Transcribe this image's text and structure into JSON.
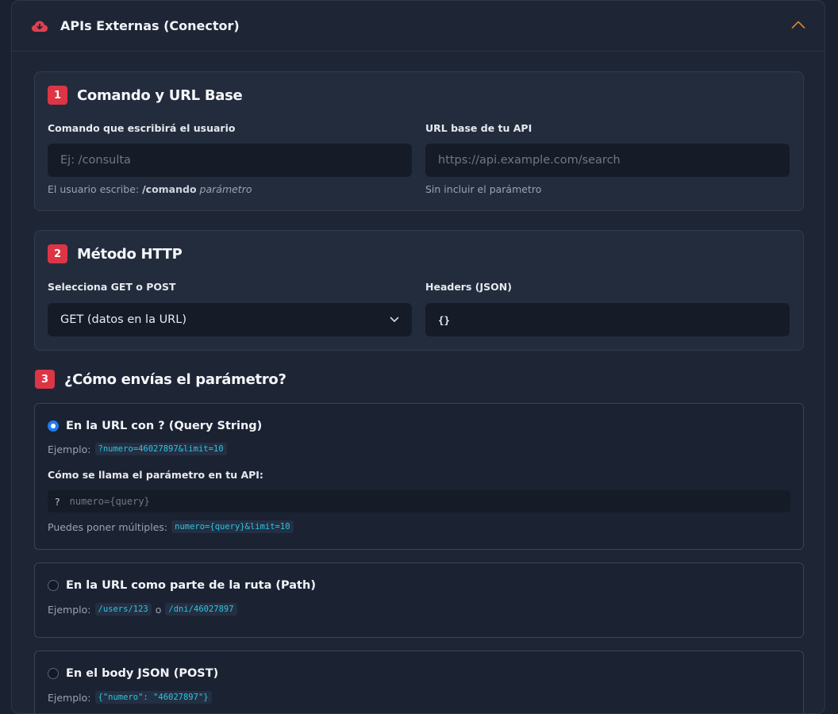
{
  "header": {
    "title": "APIs Externas (Conector)"
  },
  "step1": {
    "number": "1",
    "title": "Comando y URL Base",
    "command_label": "Comando que escribirá el usuario",
    "command_placeholder": "Ej: /consulta",
    "command_help_prefix": "El usuario escribe: ",
    "command_help_bold": "/comando",
    "command_help_italic": "parámetro",
    "url_label": "URL base de tu API",
    "url_placeholder": "https://api.example.com/search",
    "url_help": "Sin incluir el parámetro"
  },
  "step2": {
    "number": "2",
    "title": "Método HTTP",
    "method_label": "Selecciona GET o POST",
    "method_value": "GET (datos en la URL)",
    "headers_label": "Headers (JSON)",
    "headers_value": "{}"
  },
  "step3": {
    "number": "3",
    "title": "¿Cómo envías el parámetro?",
    "options": [
      {
        "label": "En la URL con ? (Query String)",
        "checked": true,
        "example_label": "Ejemplo:",
        "example_code": "?numero=46027897&limit=10",
        "param_label": "Cómo se llama el parámetro en tu API:",
        "param_prefix": "?",
        "param_placeholder": "numero={query}",
        "multi_label": "Puedes poner múltiples:",
        "multi_code": "numero={query}&limit=10"
      },
      {
        "label": "En la URL como parte de la ruta (Path)",
        "checked": false,
        "example_label": "Ejemplo:",
        "example_code_1": "/users/123",
        "example_sep": "o",
        "example_code_2": "/dni/46027897"
      },
      {
        "label": "En el body JSON (POST)",
        "checked": false,
        "example_label": "Ejemplo:",
        "example_code": "{\"numero\": \"46027897\"}"
      }
    ]
  },
  "colors": {
    "accent_red": "#dc3545",
    "radio_blue": "#1e7bf2",
    "code_cyan": "#2fc4e0",
    "chevron_orange": "#d9822b"
  }
}
